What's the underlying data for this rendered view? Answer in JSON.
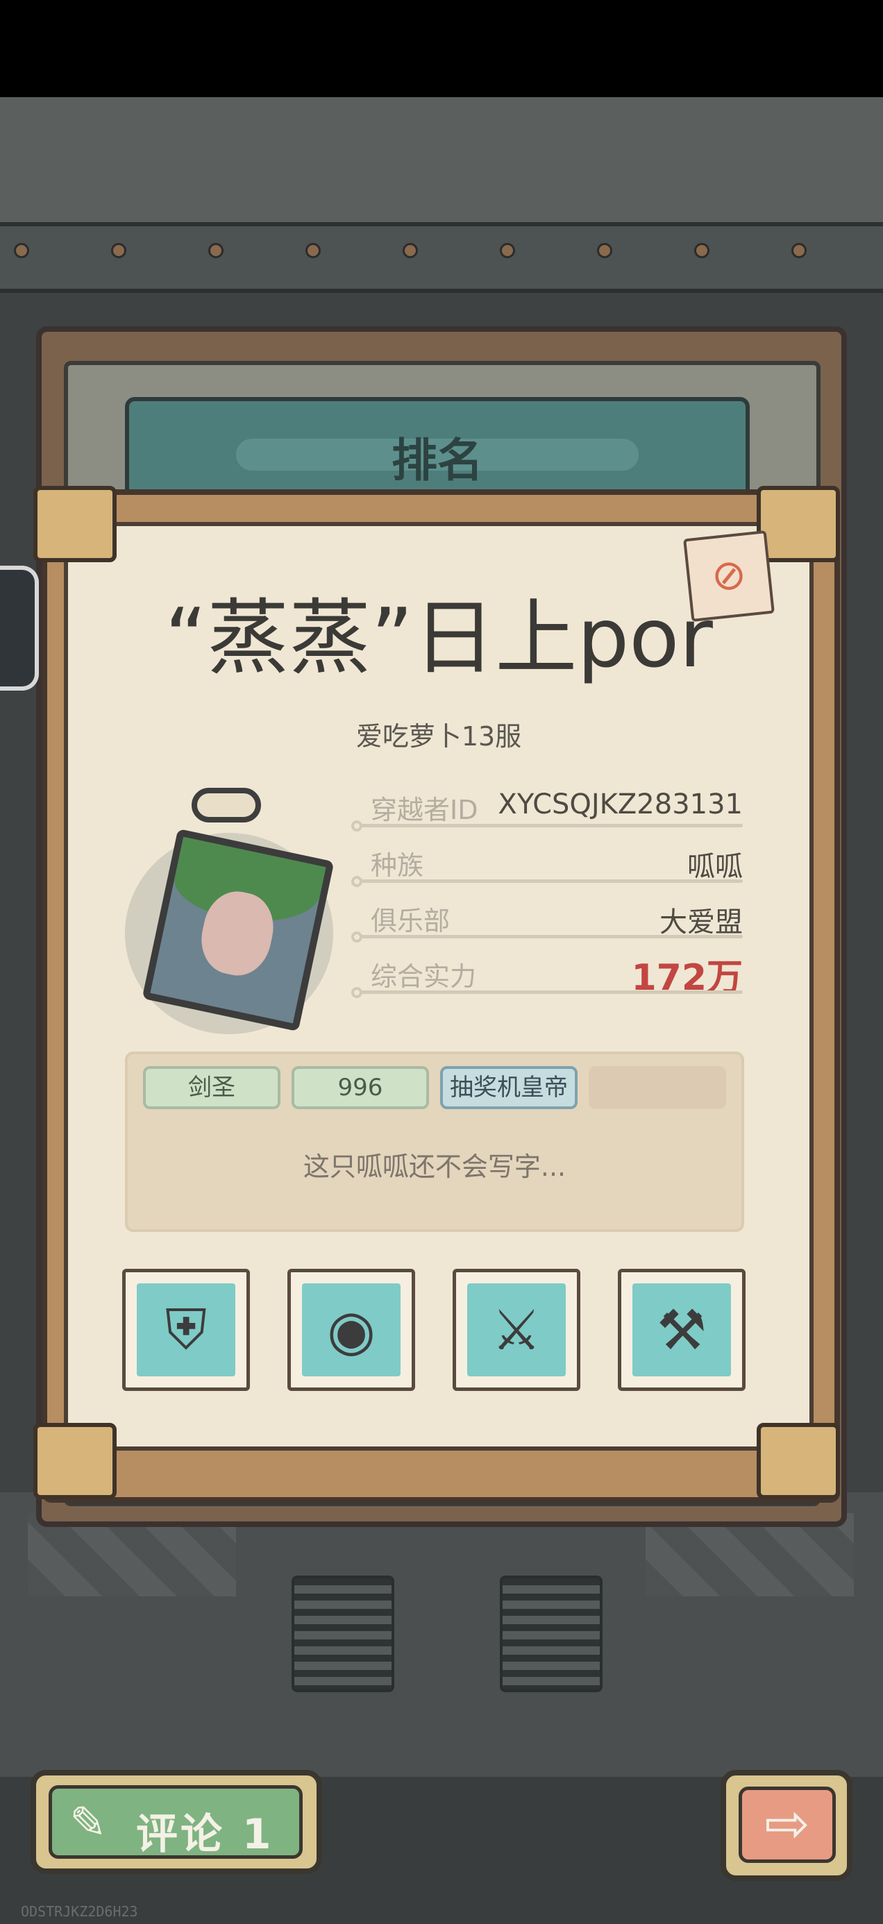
{
  "panel": {
    "title": "排名"
  },
  "player": {
    "name": "“蒸蒸”日上por",
    "server": "爱吃萝卜13服",
    "info": [
      {
        "label": "穿越者ID",
        "value": "XYCSQJKZ283131"
      },
      {
        "label": "种族",
        "value": "呱呱"
      },
      {
        "label": "俱乐部",
        "value": "大爱盟"
      },
      {
        "label": "综合实力",
        "value": "172万"
      }
    ],
    "tags": [
      "剑圣",
      "996",
      "抽奖机皇帝"
    ],
    "bio": "这只呱呱还不会写字...",
    "badges": [
      "shield-badge-icon",
      "winged-eye-badge-icon",
      "crossed-swords-badge-icon",
      "toolbox-badge-icon"
    ]
  },
  "footer": {
    "comment_label": "评论 1",
    "comment_icon": "pen-icon",
    "next_icon": "arrow-right-icon",
    "device_code": "ODSTRJKZ2D6H23"
  },
  "colors": {
    "power": "#c24642",
    "comment_button": "#7fb381",
    "next_button": "#e79b83"
  }
}
